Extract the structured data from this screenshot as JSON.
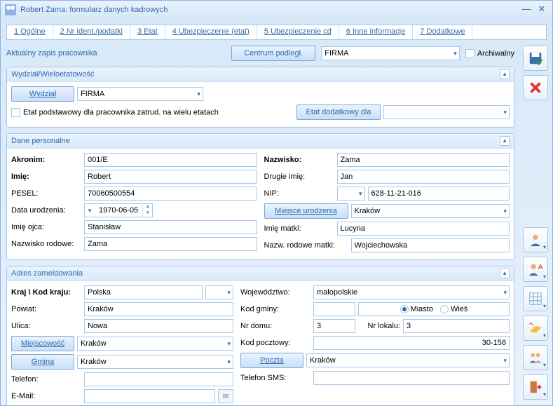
{
  "window": {
    "title": "Robert Zama: formularz danych kadrowych"
  },
  "tabs": [
    {
      "num": "1",
      "label": "Ogólne"
    },
    {
      "num": "2",
      "label": "Nr ident./podatki"
    },
    {
      "num": "3",
      "label": "Etat"
    },
    {
      "num": "4",
      "label": "Ubezpieczenie (etat)"
    },
    {
      "num": "5",
      "label": "Ubezpieczenie cd"
    },
    {
      "num": "6",
      "label": "Inne informacje"
    },
    {
      "num": "7",
      "label": "Dodatkowe"
    }
  ],
  "top": {
    "label": "Aktualny zapis pracownika",
    "center_btn": "Centrum podległ.",
    "firma": "FIRMA",
    "archive": "Archiwalny"
  },
  "group1": {
    "title": "Wydział/Wieloetatowość",
    "wydzial_btn": "Wydział",
    "wydzial_val": "FIRMA",
    "etat_chk": "Etat podstawowy dla pracownika zatrud. na wielu etatach",
    "etat_btn": "Etat dodatkowy dla"
  },
  "group2": {
    "title": "Dane personalne",
    "akronim_l": "Akronim:",
    "akronim": "001/E",
    "imie_l": "Imię:",
    "imie": "Robert",
    "pesel_l": "PESEL:",
    "pesel": "70060500554",
    "data_l": "Data urodzenia:",
    "data": "1970-06-05",
    "ojciec_l": "Imię ojca:",
    "ojciec": "Stanisław",
    "rodowe_l": "Nazwisko rodowe:",
    "rodowe": "Zama",
    "nazwisko_l": "Nazwisko:",
    "nazwisko": "Zama",
    "drugie_l": "Drugie imię:",
    "drugie": "Jan",
    "nip_l": "NIP:",
    "nip": "628-11-21-016",
    "miejsce_btn": "Miejsce urodzenia",
    "miejsce": "Kraków",
    "matka_l": "Imię matki:",
    "matka": "Lucyna",
    "rodowe_m_l": "Nazw. rodowe matki:",
    "rodowe_m": "Wojciechowska"
  },
  "group3": {
    "title": "Adres zameldowania",
    "kraj_l": "Kraj \\ Kod kraju:",
    "kraj": "Polska",
    "powiat_l": "Powiat:",
    "powiat": "Kraków",
    "ulica_l": "Ulica:",
    "ulica": "Nowa",
    "miejscowosc_btn": "Miejscowość",
    "miejscowosc": "Kraków",
    "gmina_btn": "Gmina",
    "gmina": "Kraków",
    "telefon_l": "Telefon:",
    "telefon": "",
    "email_l": "E-Mail:",
    "email": "",
    "woj_l": "Województwo:",
    "woj": "małopolskie",
    "kod_gminy_l": "Kod gminy:",
    "miasto": "Miasto",
    "wies": "Wieś",
    "nrdomu_l": "Nr domu:",
    "nrdomu": "3",
    "nrlokalu_l": "Nr lokalu:",
    "nrlokalu": "3",
    "kodp_l": "Kod pocztowy:",
    "kodp": "30-156",
    "poczta_btn": "Poczta",
    "poczta": "Kraków",
    "sms_l": "Telefon SMS:",
    "sms": ""
  }
}
